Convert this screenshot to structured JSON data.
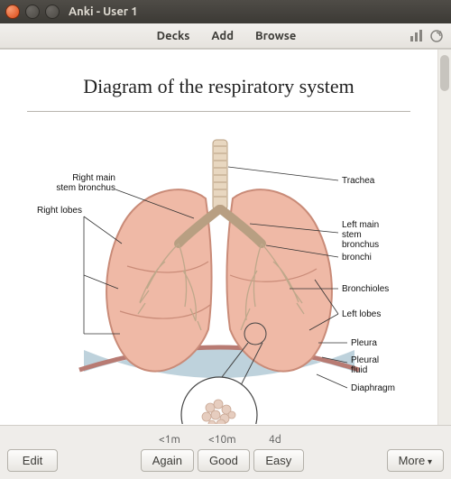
{
  "window": {
    "title": "Anki - User 1"
  },
  "menu": {
    "decks": "Decks",
    "add": "Add",
    "browse": "Browse"
  },
  "card": {
    "title": "Diagram of the respiratory system",
    "labels": {
      "right_main_stem_bronchus": "Right main\nstem bronchus",
      "right_lobes": "Right lobes",
      "trachea": "Trachea",
      "left_main_stem_bronchus": "Left main\nstem\nbronchus",
      "bronchi": "bronchi",
      "bronchioles": "Bronchioles",
      "left_lobes": "Left lobes",
      "pleura": "Pleura",
      "pleural_fluid": "Pleural\nfluid",
      "diaphragm": "Diaphragm"
    }
  },
  "intervals": {
    "again": "<1m",
    "good": "<10m",
    "easy": "4d"
  },
  "buttons": {
    "edit": "Edit",
    "again": "Again",
    "good": "Good",
    "easy": "Easy",
    "more": "More"
  }
}
